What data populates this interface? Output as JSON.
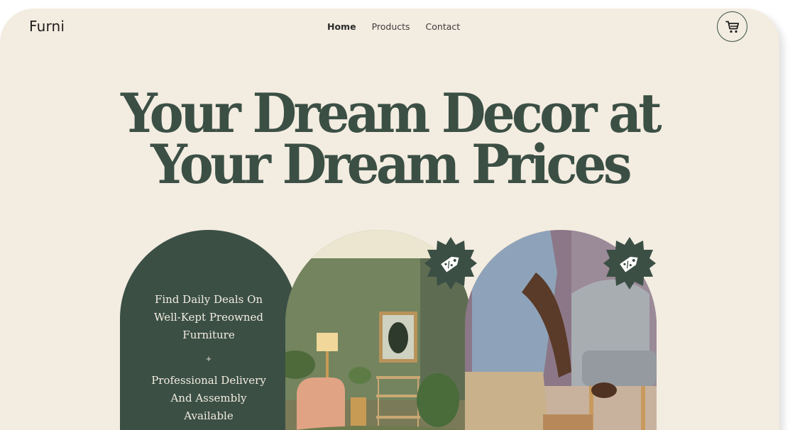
{
  "brand": {
    "logo": "Furni"
  },
  "nav": {
    "items": [
      "Home",
      "Products",
      "Contact"
    ],
    "active": "Home"
  },
  "header": {
    "cart_icon": "cart-icon"
  },
  "hero": {
    "title_line1": "Your Dream Decor at",
    "title_line2": "Your Dream Prices"
  },
  "promo": {
    "deals_text": "Find Daily Deals On Well-Kept Preowned Furniture",
    "separator": "+",
    "delivery_text": "Professional Delivery And Assembly Available"
  },
  "badges": {
    "icon": "percent-tag-icon"
  },
  "colors": {
    "background": "#f3ece0",
    "accent_green": "#3b4f45",
    "text_dark": "#1e1e1e"
  }
}
